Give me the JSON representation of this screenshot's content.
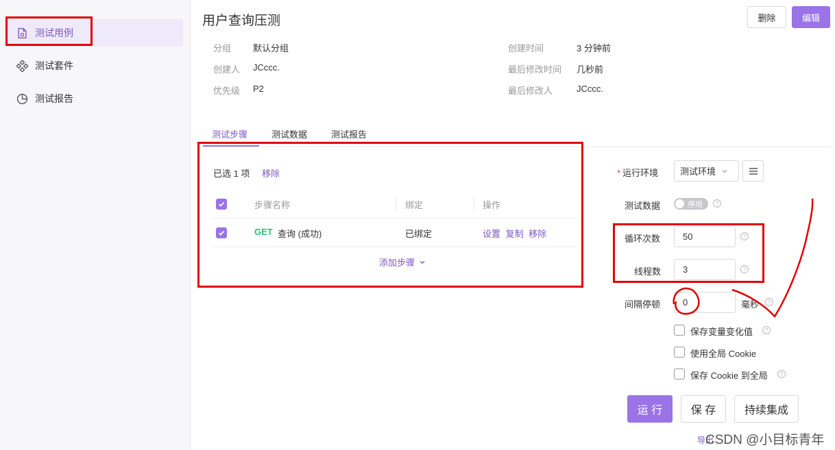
{
  "sidebar": {
    "items": [
      {
        "label": "测试用例",
        "icon": "file-code-icon",
        "active": true
      },
      {
        "label": "测试套件",
        "icon": "suite-icon",
        "active": false
      },
      {
        "label": "测试报告",
        "icon": "pie-chart-icon",
        "active": false
      }
    ]
  },
  "header": {
    "title": "用户查询压测",
    "delete_label": "删除",
    "edit_label": "编辑"
  },
  "info": {
    "group_label": "分组",
    "group_value": "默认分组",
    "creator_label": "创建人",
    "creator_value": "JCccc.",
    "priority_label": "优先级",
    "priority_value": "P2",
    "created_label": "创建时间",
    "created_value": "3 分钟前",
    "modified_label": "最后修改时间",
    "modified_value": "几秒前",
    "modifier_label": "最后修改人",
    "modifier_value": "JCccc."
  },
  "tabs": [
    {
      "label": "测试步骤",
      "active": true
    },
    {
      "label": "测试数据",
      "active": false
    },
    {
      "label": "测试报告",
      "active": false
    }
  ],
  "steps": {
    "selected_text": "已选 1 项",
    "remove_selected": "移除",
    "columns": [
      "步骤名称",
      "绑定",
      "操作"
    ],
    "rows": [
      {
        "method": "GET",
        "name": "查询 (成功)",
        "bind": "已绑定",
        "ops": [
          "设置",
          "复制",
          "移除"
        ]
      }
    ],
    "add_step": "添加步骤"
  },
  "form": {
    "env_label": "运行环境",
    "env_value": "测试环境",
    "data_label": "测试数据",
    "data_toggle": "停用",
    "loop_label": "循环次数",
    "loop_value": "50",
    "threads_label": "线程数",
    "threads_value": "3",
    "interval_label": "间隔停顿",
    "interval_value": "0",
    "interval_unit": "毫秒",
    "cb_save_vars": "保存变量变化值",
    "cb_global_cookie": "使用全局 Cookie",
    "cb_save_cookie": "保存 Cookie 到全局"
  },
  "actions": {
    "run": "运 行",
    "save": "保 存",
    "ci": "持续集成"
  },
  "footer": {
    "nav": "导出",
    "watermark": "CSDN @小目标青年"
  },
  "colors": {
    "accent": "#9a73e6",
    "accent_text": "#7e57c2",
    "method_get": "#2bbf7a",
    "annotation_red": "#e00000"
  }
}
